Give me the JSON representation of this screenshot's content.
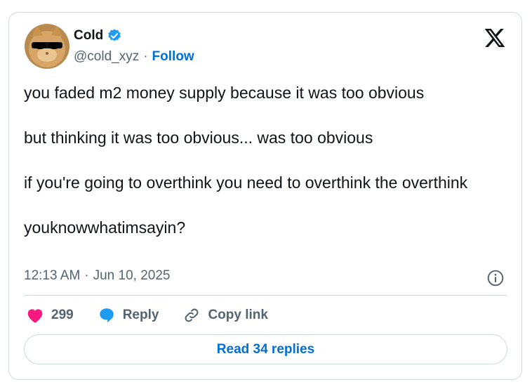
{
  "author": {
    "name": "Cold",
    "handle": "@cold_xyz",
    "separator": "·",
    "follow_label": "Follow",
    "avatar_icon": "cat-with-sunglasses-avatar",
    "verified_icon": "verified-badge-icon"
  },
  "tweet": {
    "paragraphs": [
      "you faded m2 money supply because it was too obvious",
      "but thinking it was too obvious... was too obvious",
      "if you're going to overthink you need to overthink the overthink",
      "youknowwhatimsayin?"
    ],
    "time": "12:13 AM",
    "separator": "·",
    "date": "Jun 10, 2025"
  },
  "actions": {
    "likes_count": "299",
    "reply_label": "Reply",
    "copy_link_label": "Copy link",
    "read_replies_label": "Read 34 replies"
  },
  "colors": {
    "like": "#f91880",
    "link_blue": "#006fd6",
    "reply_bubble": "#1d9bf0",
    "muted": "#536471",
    "border": "#cfd9de"
  }
}
